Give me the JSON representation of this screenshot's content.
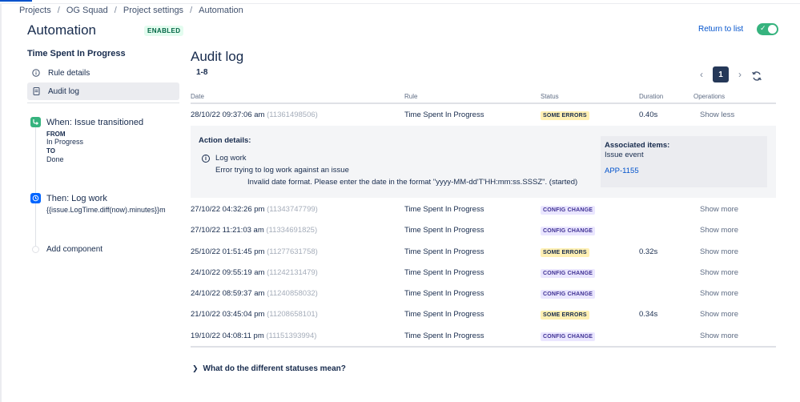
{
  "breadcrumb": [
    "Projects",
    "OG Squad",
    "Project settings",
    "Automation"
  ],
  "header": {
    "title": "Automation",
    "status_badge": "ENABLED",
    "return_link": "Return to list",
    "toggle_on": true
  },
  "sidebar": {
    "rule_name": "Time Spent In Progress",
    "items": [
      {
        "label": "Rule details",
        "icon": "info-icon"
      },
      {
        "label": "Audit log",
        "icon": "document-icon"
      }
    ],
    "trigger": {
      "title": "When: Issue transitioned",
      "from_label": "FROM",
      "from_value": "In Progress",
      "to_label": "TO",
      "to_value": "Done"
    },
    "action": {
      "title": "Then: Log work",
      "expression": "{{issue.LogTime.diff(now).minutes}}m"
    },
    "add_component": "Add component"
  },
  "audit": {
    "title": "Audit log",
    "range": "1-8",
    "page": "1",
    "columns": [
      "Date",
      "Rule",
      "Status",
      "Duration",
      "Operations"
    ],
    "rows": [
      {
        "date": "28/10/22 09:37:06 am",
        "id": "(11361498506)",
        "rule": "Time Spent In Progress",
        "status": "SOME ERRORS",
        "duration": "0.40s",
        "op": "Show less"
      },
      {
        "date": "27/10/22 04:32:26 pm",
        "id": "(11343747799)",
        "rule": "Time Spent In Progress",
        "status": "CONFIG CHANGE",
        "duration": "",
        "op": "Show more"
      },
      {
        "date": "27/10/22 11:21:03 am",
        "id": "(11334691825)",
        "rule": "Time Spent In Progress",
        "status": "CONFIG CHANGE",
        "duration": "",
        "op": "Show more"
      },
      {
        "date": "25/10/22 01:51:45 pm",
        "id": "(11277631758)",
        "rule": "Time Spent In Progress",
        "status": "SOME ERRORS",
        "duration": "0.32s",
        "op": "Show more"
      },
      {
        "date": "24/10/22 09:55:19 am",
        "id": "(11242131479)",
        "rule": "Time Spent In Progress",
        "status": "CONFIG CHANGE",
        "duration": "",
        "op": "Show more"
      },
      {
        "date": "24/10/22 08:59:37 am",
        "id": "(11240858032)",
        "rule": "Time Spent In Progress",
        "status": "CONFIG CHANGE",
        "duration": "",
        "op": "Show more"
      },
      {
        "date": "21/10/22 03:45:04 pm",
        "id": "(11208658101)",
        "rule": "Time Spent In Progress",
        "status": "SOME ERRORS",
        "duration": "0.34s",
        "op": "Show more"
      },
      {
        "date": "19/10/22 04:08:11 pm",
        "id": "(11151393994)",
        "rule": "Time Spent In Progress",
        "status": "CONFIG CHANGE",
        "duration": "",
        "op": "Show more"
      }
    ],
    "details": {
      "title": "Action details:",
      "action": "Log work",
      "error": "Error trying to log work against an issue",
      "message": "Invalid date format. Please enter the date in the format \"yyyy-MM-dd'T'HH:mm:ss.SSSZ\". (started)",
      "assoc_title": "Associated items:",
      "assoc_sub": "Issue event",
      "assoc_link": "APP-1155"
    },
    "help": "What do the different statuses mean?"
  },
  "colors": {
    "accent": "#0052cc",
    "success": "#36b37e",
    "error_lozenge": "#fff0b3",
    "config_lozenge": "#eae6ff"
  }
}
